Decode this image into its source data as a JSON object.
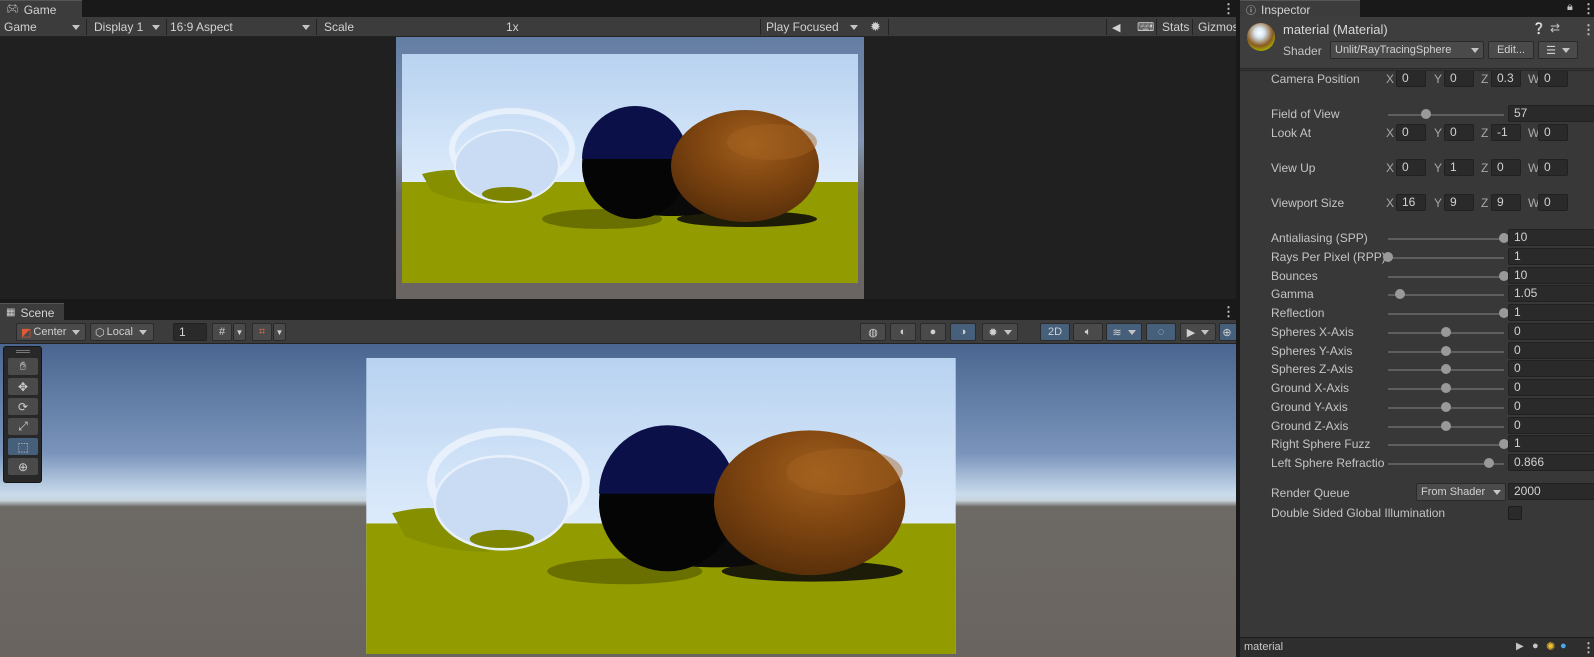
{
  "game": {
    "tab_label": "Game",
    "view_dropdown": "Game",
    "display_dropdown": "Display 1",
    "aspect_dropdown": "16:9 Aspect",
    "scale_label": "Scale",
    "scale_value": "1x",
    "scale_fraction": 0.0,
    "play_mode_dropdown": "Play Focused",
    "stats_label": "Stats",
    "gizmos_label": "Gizmos"
  },
  "scene": {
    "tab_label": "Scene",
    "pivot_dropdown": "Center",
    "space_dropdown": "Local",
    "grid_size_value": "1",
    "mode_2d_label": "2D",
    "tools": [
      "hand-icon",
      "move-icon",
      "rotate-icon",
      "scale-icon",
      "rect-icon",
      "transform-icon"
    ],
    "active_tool_index": 4
  },
  "inspector": {
    "tab_label": "Inspector",
    "material_title": "material (Material)",
    "shader_label": "Shader",
    "shader_value": "Unlit/RayTracingSphere",
    "edit_button": "Edit...",
    "vector_props": [
      {
        "label": "Camera Position",
        "x": "0",
        "y": "0",
        "z": "0.3",
        "w": "0"
      },
      {
        "label": "Look At",
        "x": "0",
        "y": "0",
        "z": "-1",
        "w": "0"
      },
      {
        "label": "View Up",
        "x": "0",
        "y": "1",
        "z": "0",
        "w": "0"
      },
      {
        "label": "Viewport Size",
        "x": "16",
        "y": "9",
        "z": "9",
        "w": "0"
      }
    ],
    "axis_labels": {
      "x": "X",
      "y": "Y",
      "z": "Z",
      "w": "W"
    },
    "fov": {
      "label": "Field of View",
      "value": "57",
      "fraction": 0.33
    },
    "sliders": [
      {
        "label": "Antialiasing (SPP)",
        "value": "10",
        "fraction": 1.0
      },
      {
        "label": "Rays Per Pixel (RPP)",
        "value": "1",
        "fraction": 0.0
      },
      {
        "label": "Bounces",
        "value": "10",
        "fraction": 1.0
      },
      {
        "label": "Gamma",
        "value": "1.05",
        "fraction": 0.1
      },
      {
        "label": "Reflection",
        "value": "1",
        "fraction": 1.0
      },
      {
        "label": "Spheres X-Axis",
        "value": "0",
        "fraction": 0.5
      },
      {
        "label": "Spheres Y-Axis",
        "value": "0",
        "fraction": 0.5
      },
      {
        "label": "Spheres Z-Axis",
        "value": "0",
        "fraction": 0.5
      },
      {
        "label": "Ground X-Axis",
        "value": "0",
        "fraction": 0.5
      },
      {
        "label": "Ground Y-Axis",
        "value": "0",
        "fraction": 0.5
      },
      {
        "label": "Ground Z-Axis",
        "value": "0",
        "fraction": 0.5
      },
      {
        "label": "Right Sphere Fuzz",
        "value": "1",
        "fraction": 1.0
      },
      {
        "label": "Left Sphere Refractio",
        "value": "0.866",
        "fraction": 0.87
      }
    ],
    "render_queue": {
      "label": "Render Queue",
      "dropdown": "From Shader",
      "value": "2000"
    },
    "double_sided_gi": {
      "label": "Double Sided Global Illumination",
      "checked": false
    },
    "preview_name": "material"
  },
  "colors": {
    "accent_blue": "#46607c",
    "sky_top": "#b9d3ef",
    "ground": "#929c00",
    "right_sphere": "#8a4a10",
    "middle_sphere_top": "#0a1040"
  }
}
